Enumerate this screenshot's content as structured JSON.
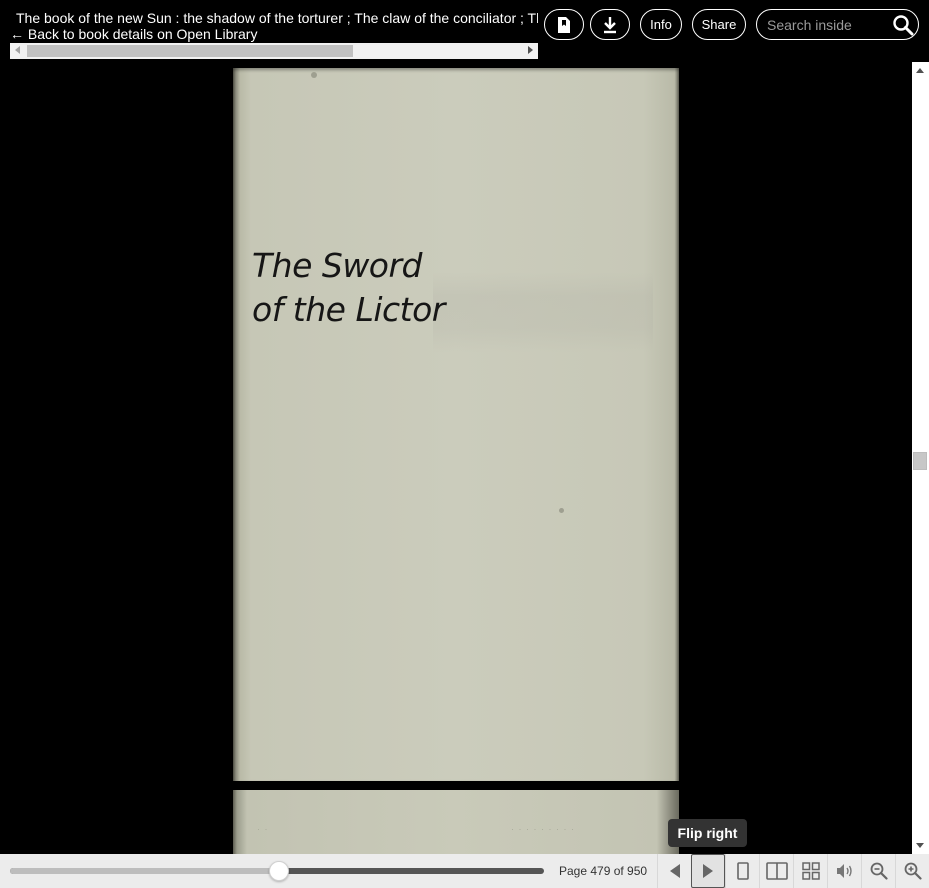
{
  "header": {
    "book_title": "The book of the new Sun : the shadow of the torturer ; The claw of the conciliator ; The sword of the lictor ; The citadel of the autarch",
    "back_link": "← Back to book details on Open Library",
    "info_label": "Info",
    "share_label": "Share",
    "search_placeholder": "Search inside",
    "icons": {
      "bookmark": "bookmark-page-icon",
      "download": "download-icon",
      "search": "search-icon"
    }
  },
  "page": {
    "title_line1": "The Sword",
    "title_line2": "of the Lictor"
  },
  "tooltip": {
    "text": "Flip right"
  },
  "toolbar": {
    "page_label": "Page 479 of 950",
    "current_page": 479,
    "total_pages": 950,
    "icons": [
      "flip-left-icon",
      "flip-right-icon",
      "one-page-view-icon",
      "two-page-view-icon",
      "thumbnail-view-icon",
      "read-aloud-icon",
      "zoom-out-icon",
      "zoom-in-icon"
    ]
  },
  "colors": {
    "background": "#000000",
    "toolbar": "#ececec",
    "tooltip": "#333333"
  }
}
